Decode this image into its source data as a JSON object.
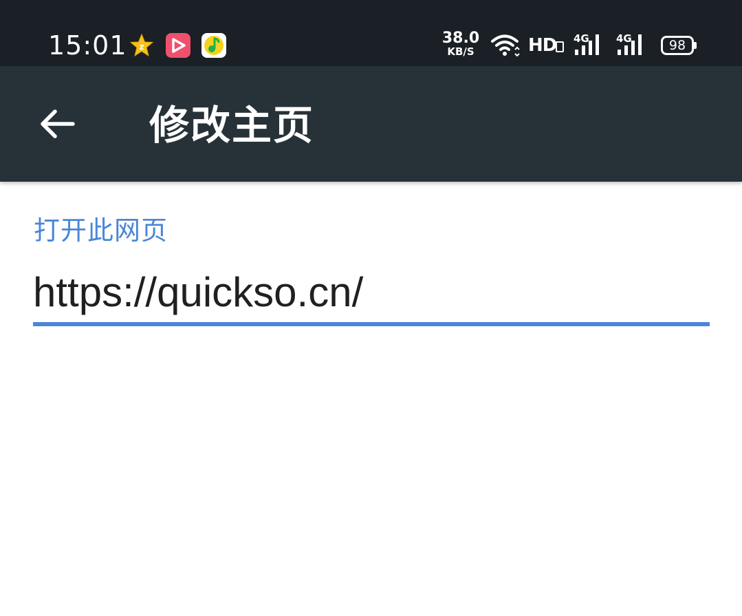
{
  "status_bar": {
    "time": "15:01",
    "notification_icons": [
      "star-app-icon",
      "video-app-icon",
      "music-app-icon"
    ],
    "net_speed_value": "38.0",
    "net_speed_unit": "KB/S",
    "hd_label": "HD",
    "signal_1_label": "4G",
    "signal_2_label": "4G",
    "battery_level": "98"
  },
  "app_bar": {
    "back_icon": "arrow-left-icon",
    "title": "修改主页"
  },
  "form": {
    "label": "打开此网页",
    "url_value": "https://quickso.cn/"
  },
  "colors": {
    "status_bar_bg": "#1a2025",
    "app_bar_bg": "#263238",
    "accent": "#4a86d8",
    "text": "#202020"
  }
}
